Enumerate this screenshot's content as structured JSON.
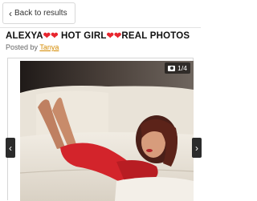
{
  "nav": {
    "back_label": "Back to results"
  },
  "post": {
    "title_prefix": "ALEXYA",
    "title_middle": " HOT GIRL",
    "title_suffix": "REAL PHOTOS",
    "heart": "❤",
    "posted_by_label": "Posted by",
    "author": "Tanya"
  },
  "gallery": {
    "counter": "1/4",
    "prev_icon": "chevron-left-icon",
    "next_icon": "chevron-right-icon"
  },
  "colors": {
    "heart": "#e8262e",
    "author_link": "#d48a00",
    "dress": "#d3242b"
  }
}
